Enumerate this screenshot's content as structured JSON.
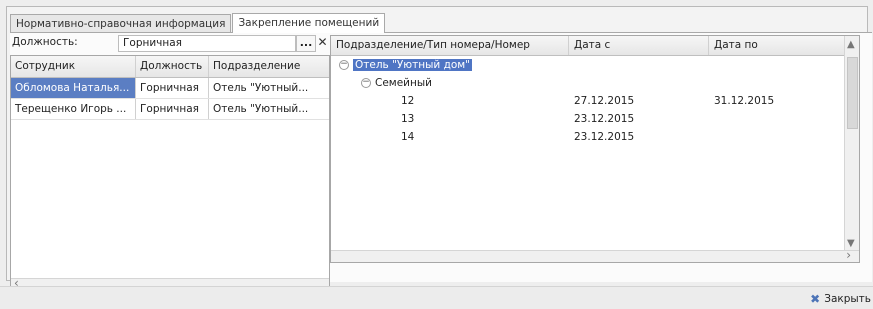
{
  "tabs": [
    {
      "label": "Нормативно-справочная информация"
    },
    {
      "label": "Закрепление помещений"
    }
  ],
  "filter": {
    "label": "Должность:",
    "value": "Горничная",
    "select_button": "...",
    "clear_button": "✕"
  },
  "left_table": {
    "columns": [
      "Сотрудник",
      "Должность",
      "Подразделение"
    ],
    "rows": [
      {
        "employee": "Обломова Наталья...",
        "position": "Горничная",
        "department": "Отель \"Уютный..."
      },
      {
        "employee": "Терещенко Игорь ...",
        "position": "Горничная",
        "department": "Отель \"Уютный..."
      }
    ]
  },
  "right_table": {
    "columns": [
      "Подразделение/Тип номера/Номер",
      "Дата с",
      "Дата по"
    ],
    "rows": [
      {
        "text": "Отель \"Уютный дом\"",
        "date_from": "",
        "date_to": ""
      },
      {
        "text": "Семейный",
        "date_from": "",
        "date_to": ""
      },
      {
        "text": "12",
        "date_from": "27.12.2015",
        "date_to": "31.12.2015"
      },
      {
        "text": "13",
        "date_from": "23.12.2015",
        "date_to": ""
      },
      {
        "text": "14",
        "date_from": "23.12.2015",
        "date_to": ""
      }
    ]
  },
  "footer": {
    "close_label": "Закрыть"
  },
  "colors": {
    "selection": "#5b7ec3",
    "tree_highlight": "#4f75c4",
    "close_icon": "#4d74b7"
  },
  "icons": {
    "collapse": "minus-circle-icon",
    "close": "close-icon"
  }
}
